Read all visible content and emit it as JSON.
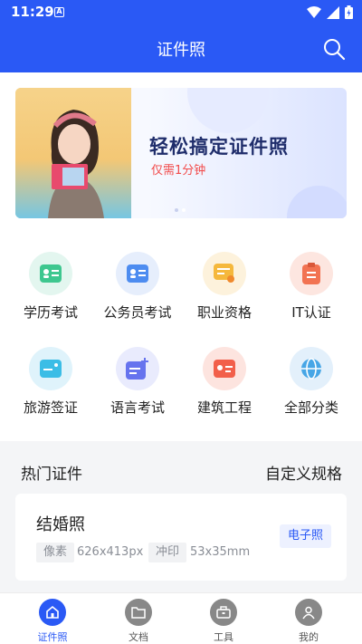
{
  "status_bar": {
    "time": "11:29",
    "notification_icon": "A"
  },
  "app_bar": {
    "title": "证件照",
    "search_icon": "search-icon"
  },
  "banner": {
    "headline": "轻松搞定证件照",
    "subline": "仅需1分钟",
    "accent": "#f24a4a",
    "slide_count": 2,
    "active_slide": 2
  },
  "categories": [
    {
      "label": "学历考试",
      "icon": "id-card-icon",
      "bg": "#e3f6ef",
      "fg": "#3ec78f"
    },
    {
      "label": "公务员考试",
      "icon": "id-card-icon",
      "bg": "#e6eefc",
      "fg": "#4d8cf0"
    },
    {
      "label": "职业资格",
      "icon": "certificate-icon",
      "bg": "#fdf2dc",
      "fg": "#f5b83c"
    },
    {
      "label": "IT认证",
      "icon": "clipboard-icon",
      "bg": "#fde6e0",
      "fg": "#f27352"
    },
    {
      "label": "旅游签证",
      "icon": "ticket-icon",
      "bg": "#dff3fb",
      "fg": "#3bbde6"
    },
    {
      "label": "语言考试",
      "icon": "document-add-icon",
      "bg": "#e9ebfd",
      "fg": "#6673ee"
    },
    {
      "label": "建筑工程",
      "icon": "id-card-icon",
      "bg": "#fde4df",
      "fg": "#f25f4a"
    },
    {
      "label": "全部分类",
      "icon": "globe-icon",
      "bg": "#e3f0fb",
      "fg": "#47a6e6"
    }
  ],
  "hot": {
    "title": "热门证件",
    "custom_label": "自定义规格",
    "card": {
      "name": "结婚照",
      "pixel_label": "像素",
      "pixel_value": "626x413px",
      "print_label": "冲印",
      "print_value": "53x35mm",
      "badge": "电子照"
    }
  },
  "tabs": [
    {
      "label": "证件照",
      "icon": "home-icon",
      "active": true
    },
    {
      "label": "文档",
      "icon": "folder-icon",
      "active": false
    },
    {
      "label": "工具",
      "icon": "toolbox-icon",
      "active": false
    },
    {
      "label": "我的",
      "icon": "user-icon",
      "active": false
    }
  ],
  "colors": {
    "primary": "#2a59f5"
  }
}
